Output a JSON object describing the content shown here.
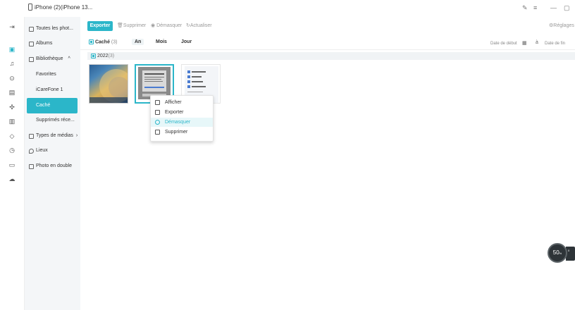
{
  "window": {
    "device_title": "iPhone (2)(iPhone 13...",
    "controls": [
      "✎",
      "≡",
      "—",
      "▢"
    ]
  },
  "rail": {
    "icons": [
      "sign-out-icon",
      "photos-icon",
      "music-icon",
      "video-icon",
      "contacts-icon",
      "apps-icon",
      "books-icon",
      "tag-icon",
      "clock-icon",
      "folder-icon",
      "cloud-icon"
    ]
  },
  "sidebar": {
    "all_photos": "Toutes les phot...",
    "albums": "Albums",
    "library": "Bibliothèque",
    "library_caret": "^",
    "favorites": "Favorites",
    "icarefone": "iCareFone 1",
    "hidden": "Caché",
    "recently_deleted": "Supprimés réce...",
    "media_types": "Types de médias",
    "media_types_caret": "›",
    "places": "Lieux",
    "duplicates": "Photo en double"
  },
  "toolbar": {
    "export": "Exporter",
    "delete": "Supprimer",
    "unhide": "Démasquer",
    "refresh": "Actualiser",
    "settings": "Réglages"
  },
  "filter": {
    "hidden_label": "Caché",
    "hidden_count": "(3)",
    "tab_year": "An",
    "tab_month": "Mois",
    "tab_day": "Jour",
    "start_date_placeholder": "Date de début",
    "to_label": "à",
    "end_date_placeholder": "Date de fin"
  },
  "group": {
    "year": "2022",
    "count": "(3)"
  },
  "context_menu": {
    "items": [
      "Afficher",
      "Exporter",
      "Démasquer",
      "Supprimer"
    ],
    "highlighted": "Démasquer"
  },
  "speed_widget": {
    "value": "50",
    "unit": "%",
    "side_up": "",
    "side_down": "0"
  },
  "colors": {
    "accent": "#2bb6c9",
    "sidebar_bg": "#f4f6f8"
  }
}
